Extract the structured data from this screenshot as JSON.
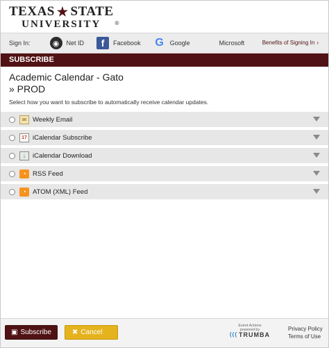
{
  "header": {
    "logo_line1_left": "TEXAS",
    "logo_line1_right": "STATE",
    "logo_line2": "UNIVERSITY",
    "logo_reg": "®"
  },
  "signin": {
    "label": "Sign In:",
    "providers": [
      {
        "label": "Net ID",
        "icon": "netid-icon"
      },
      {
        "label": "Facebook",
        "icon": "facebook-icon"
      },
      {
        "label": "Google",
        "icon": "google-icon"
      },
      {
        "label": "Microsoft",
        "icon": "microsoft-icon"
      }
    ],
    "benefits": "Benefits of Signing In",
    "benefits_caret": "›"
  },
  "subscribe_bar": "SUBSCRIBE",
  "main": {
    "title_line1": "Academic Calendar - Gato",
    "title_line2": "» PROD",
    "subtitle": "Select how you want to subscribe to automatically receive calendar updates."
  },
  "options": [
    {
      "label": "Weekly Email",
      "icon": "email-icon"
    },
    {
      "label": "iCalendar Subscribe",
      "icon": "icalendar-icon"
    },
    {
      "label": "iCalendar Download",
      "icon": "download-icon"
    },
    {
      "label": "RSS Feed",
      "icon": "rss-icon"
    },
    {
      "label": "ATOM (XML) Feed",
      "icon": "atom-icon"
    }
  ],
  "footer": {
    "subscribe_label": "Subscribe",
    "cancel_label": "Cancel",
    "trumba_line1": "Event Actions",
    "trumba_line2": "powered by",
    "trumba_brand": "TRUMBA",
    "privacy": "Privacy Policy",
    "terms": "Terms of Use"
  },
  "colors": {
    "brand_maroon": "#501214",
    "cancel_gold": "#e5b31d",
    "row_bg": "#e7e7e7"
  }
}
